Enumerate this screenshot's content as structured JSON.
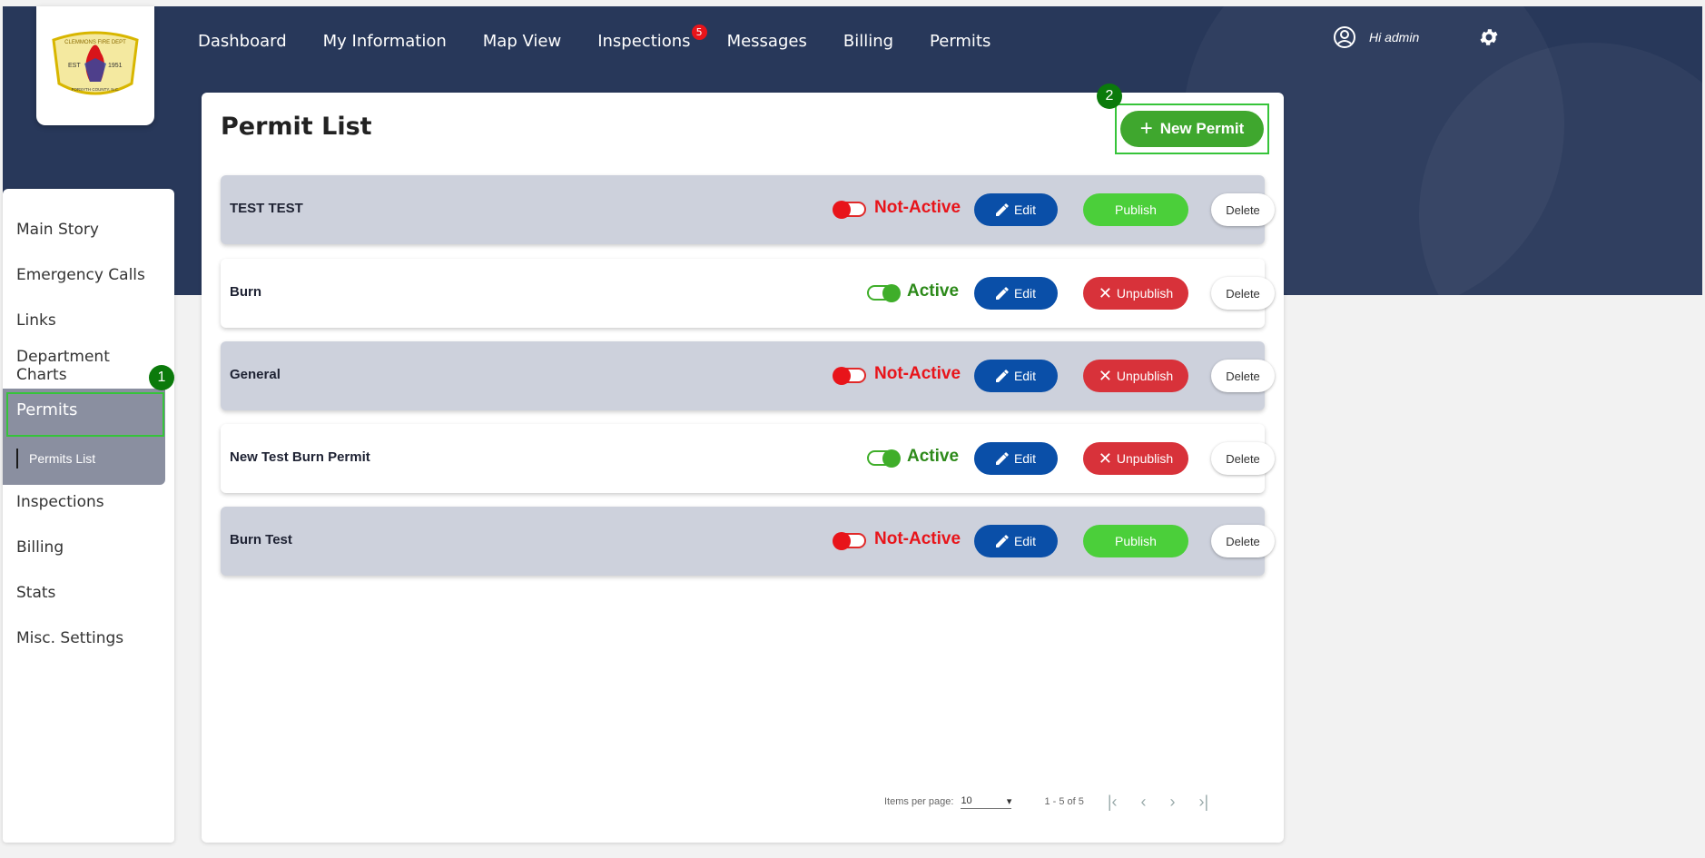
{
  "nav": {
    "items": [
      "Dashboard",
      "My Information",
      "Map View",
      "Inspections",
      "Messages",
      "Billing",
      "Permits"
    ],
    "inspections_badge": "5",
    "greeting": "Hi admin"
  },
  "logo": {
    "text_top": "CLEMMONS FIRE DEPT",
    "est": "EST",
    "year": "1951",
    "bottom": "FORSYTH COUNTY, N.C."
  },
  "sidebar": {
    "items": [
      "Main Story",
      "Emergency Calls",
      "Links",
      "Department Charts",
      "Permits",
      "Inspections",
      "Billing",
      "Stats",
      "Misc. Settings"
    ],
    "active": "Permits",
    "sub_item": "Permits List",
    "marker": "1"
  },
  "main": {
    "title": "Permit List",
    "new_button": "New Permit",
    "marker": "2",
    "edit_label": "Edit",
    "delete_label": "Delete",
    "permits": [
      {
        "name": "TEST TEST",
        "status": "Not-Active",
        "publish": "Publish"
      },
      {
        "name": "Burn",
        "status": "Active",
        "publish": "Unpublish"
      },
      {
        "name": "General",
        "status": "Not-Active",
        "publish": "Unpublish"
      },
      {
        "name": "New Test Burn Permit",
        "status": "Active",
        "publish": "Unpublish"
      },
      {
        "name": "Burn Test",
        "status": "Not-Active",
        "publish": "Publish"
      }
    ]
  },
  "pager": {
    "label": "Items per page:",
    "value": "10",
    "range": "1 - 5 of 5"
  },
  "colors": {
    "header": "#28385a",
    "active": "#2d8a1a",
    "inactive": "#e8141a",
    "edit": "#0a4fa8",
    "publish": "#4bcf3a",
    "unpublish": "#d8323a"
  }
}
